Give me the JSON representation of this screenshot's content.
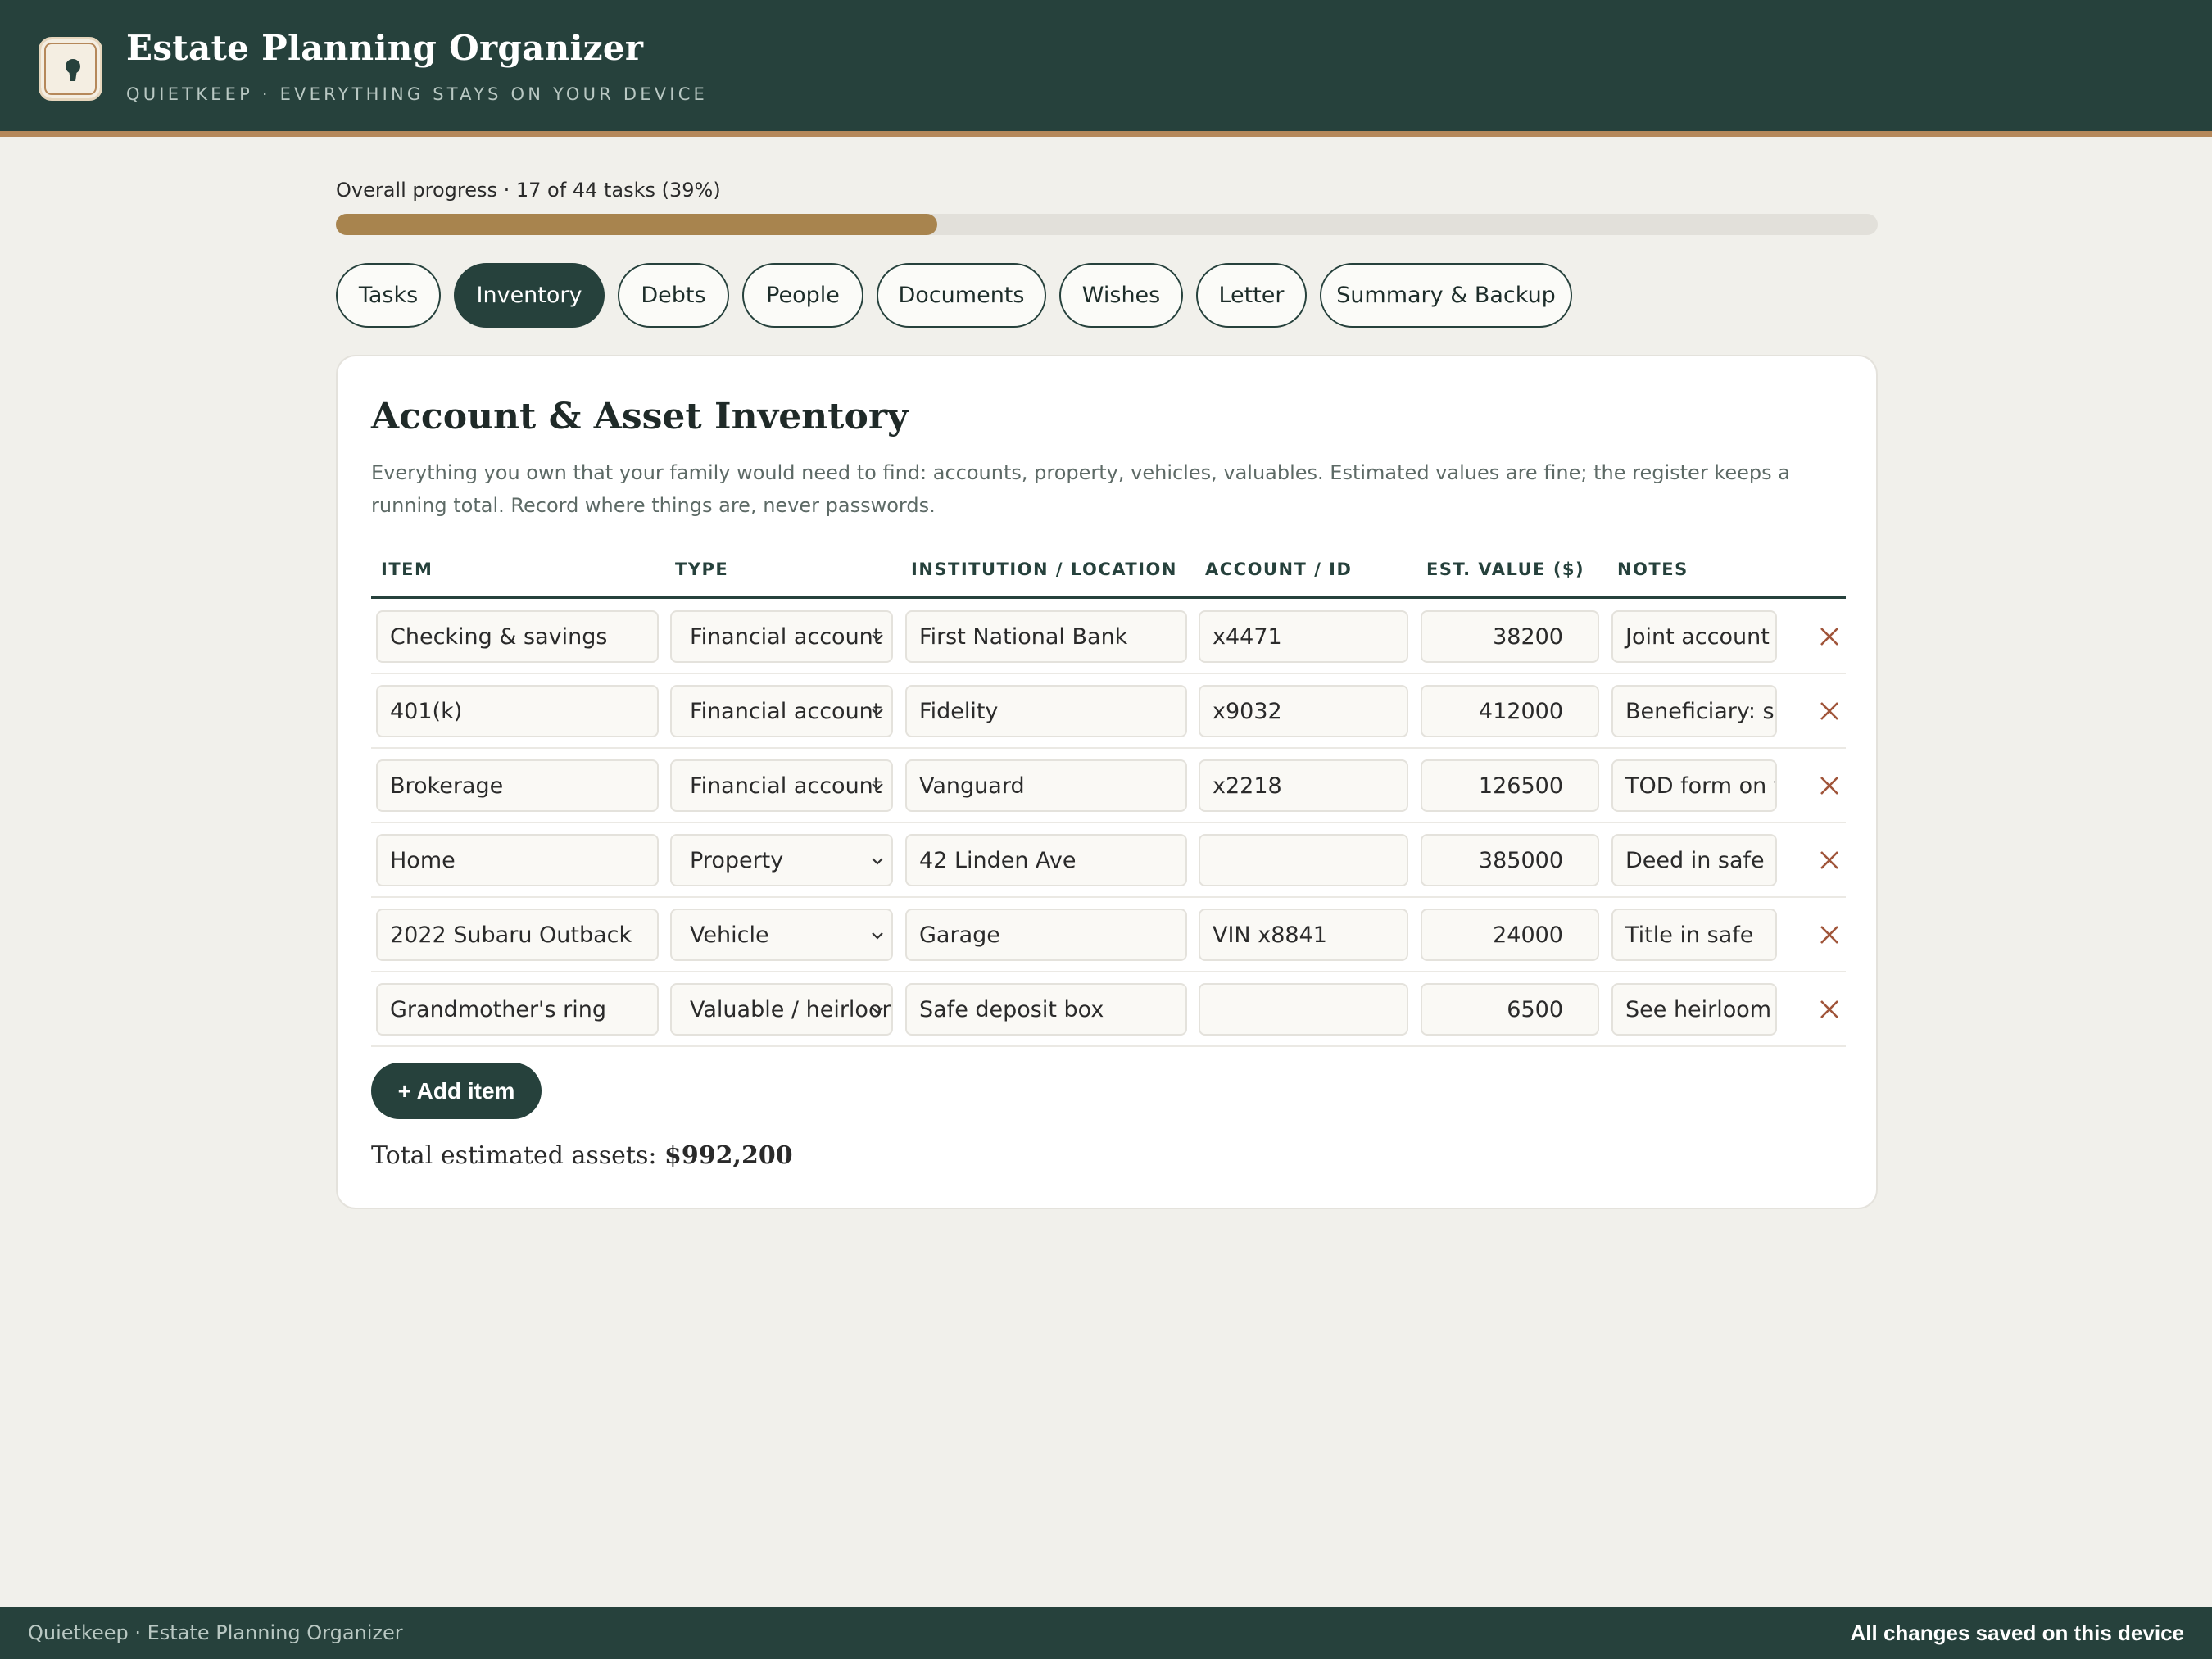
{
  "header": {
    "title": "Estate Planning Organizer",
    "subtitle": "QUIETKEEP · EVERYTHING STAYS ON YOUR DEVICE"
  },
  "progress": {
    "label": "Overall progress · 17 of 44 tasks (39%)",
    "fraction": 0.39,
    "color": "#a8844e"
  },
  "tabs": [
    {
      "label": "Tasks",
      "active": false
    },
    {
      "label": "Inventory",
      "active": true
    },
    {
      "label": "Debts",
      "active": false
    },
    {
      "label": "People",
      "active": false
    },
    {
      "label": "Documents",
      "active": false
    },
    {
      "label": "Wishes",
      "active": false
    },
    {
      "label": "Letter",
      "active": false
    },
    {
      "label": "Summary & Backup",
      "active": false
    }
  ],
  "inventory": {
    "title": "Account & Asset Inventory",
    "description": "Everything you own that your family would need to find: accounts, property, vehicles, valuables. Estimated values are fine; the register keeps a running total. Record where things are, never passwords.",
    "columns": {
      "item": "ITEM",
      "type": "TYPE",
      "location": "INSTITUTION / LOCATION",
      "account": "ACCOUNT / ID",
      "value": "EST. VALUE ($)",
      "notes": "NOTES"
    },
    "rows": [
      {
        "item": "Checking & savings",
        "type": "Financial account",
        "location": "First National Bank",
        "account": "x4471",
        "value": "38200",
        "notes": "Joint account"
      },
      {
        "item": "401(k)",
        "type": "Financial account",
        "location": "Fidelity",
        "account": "x9032",
        "value": "412000",
        "notes": "Beneficiary: sp"
      },
      {
        "item": "Brokerage",
        "type": "Financial account",
        "location": "Vanguard",
        "account": "x2218",
        "value": "126500",
        "notes": "TOD form on f"
      },
      {
        "item": "Home",
        "type": "Property",
        "location": "42 Linden Ave",
        "account": "",
        "value": "385000",
        "notes": "Deed in safe"
      },
      {
        "item": "2022 Subaru Outback",
        "type": "Vehicle",
        "location": "Garage",
        "account": "VIN x8841",
        "value": "24000",
        "notes": "Title in safe"
      },
      {
        "item": "Grandmother's ring",
        "type": "Valuable / heirloom",
        "location": "Safe deposit box",
        "account": "",
        "value": "6500",
        "notes": "See heirloom l"
      }
    ],
    "add_label": "+ Add item",
    "total_label": "Total estimated assets:",
    "total_value": "$992,200"
  },
  "footer": {
    "left": "Quietkeep · Estate Planning Organizer",
    "right": "All changes saved on this device"
  },
  "icons": {
    "logo": "keyhole-icon",
    "delete": "close-icon",
    "select": "chevron-down-icon"
  },
  "colors": {
    "brand": "#26413c",
    "accent": "#b5885a",
    "delete": "#a0553a"
  }
}
